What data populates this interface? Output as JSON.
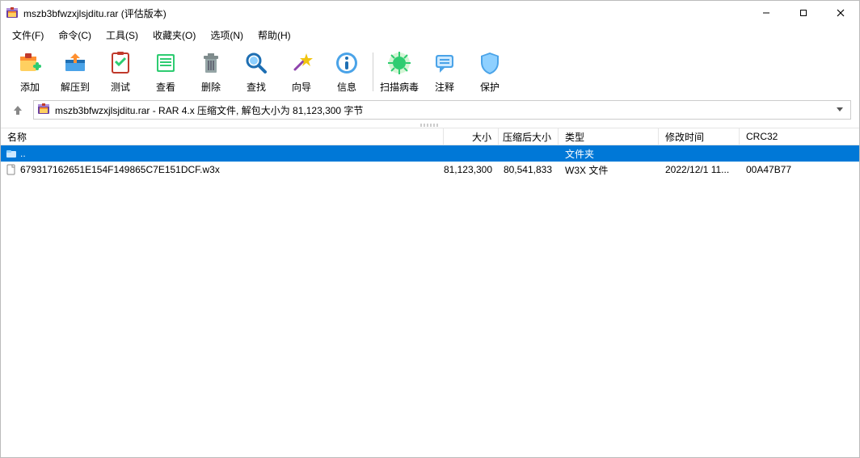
{
  "title": "mszb3bfwzxjlsjditu.rar (评估版本)",
  "menu": {
    "file": "文件(F)",
    "command": "命令(C)",
    "tools": "工具(S)",
    "favorites": "收藏夹(O)",
    "options": "选项(N)",
    "help": "帮助(H)"
  },
  "toolbar": {
    "add": "添加",
    "extract": "解压到",
    "test": "测试",
    "view": "查看",
    "delete": "删除",
    "find": "查找",
    "wizard": "向导",
    "info": "信息",
    "virusscan": "扫描病毒",
    "comment": "注释",
    "protect": "保护"
  },
  "path": "mszb3bfwzxjlsjditu.rar - RAR 4.x 压缩文件, 解包大小为 81,123,300 字节",
  "columns": {
    "name": "名称",
    "size": "大小",
    "packed": "压缩后大小",
    "type": "类型",
    "modified": "修改时间",
    "crc32": "CRC32"
  },
  "rows": [
    {
      "name": "..",
      "size": "",
      "packed": "",
      "type": "文件夹",
      "modified": "",
      "crc32": "",
      "selected": true,
      "icon": "folder-up"
    },
    {
      "name": "679317162651E154F149865C7E151DCF.w3x",
      "size": "81,123,300",
      "packed": "80,541,833",
      "type": "W3X 文件",
      "modified": "2022/12/1 11...",
      "crc32": "00A47B77",
      "selected": false,
      "icon": "file"
    }
  ]
}
